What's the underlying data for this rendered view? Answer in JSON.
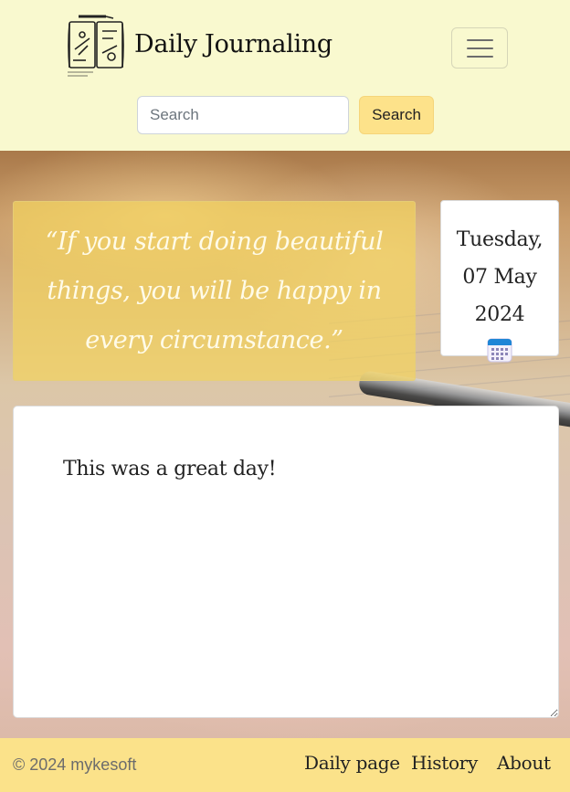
{
  "header": {
    "brand": "Daily Journaling",
    "logo_icon": "journal-logo-icon",
    "menu_icon": "hamburger-menu-icon",
    "search": {
      "placeholder": "Search",
      "value": "",
      "button_label": "Search"
    }
  },
  "quote": {
    "text": "“If you start doing beautiful things, you will be happy in every circumstance.”"
  },
  "date": {
    "text": "Tuesday, 07 May 2024",
    "icon": "calendar-icon"
  },
  "entry": {
    "value": "This was a great day!"
  },
  "footer": {
    "copyright": "© 2024 mykesoft",
    "links": [
      {
        "label": "Daily page"
      },
      {
        "label": "History"
      },
      {
        "label": "About"
      }
    ]
  },
  "colors": {
    "header_bg": "#f9f9cf",
    "search_button": "#fde28a",
    "footer_bg": "#fbe28a",
    "quote_box": "#f3d25f"
  }
}
